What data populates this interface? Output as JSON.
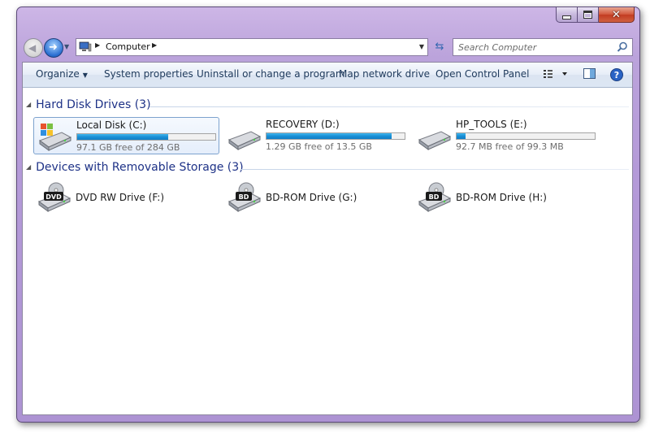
{
  "window": {
    "caption_buttons": {
      "minimize": "minimize",
      "maximize": "maximize",
      "close": "✕"
    }
  },
  "address_bar": {
    "location": "Computer",
    "icon": "computer-icon"
  },
  "search": {
    "placeholder": "Search Computer"
  },
  "toolbar": {
    "organize_label": "Organize",
    "system_properties_label": "System properties",
    "uninstall_label": "Uninstall or change a program",
    "map_network_label": "Map network drive",
    "control_panel_label": "Open Control Panel"
  },
  "groups": [
    {
      "title": "Hard Disk Drives (3)",
      "drives": [
        {
          "name": "Local Disk (C:)",
          "free_text": "97.1 GB free of 284 GB",
          "used_fraction": 0.658,
          "icon": "windows-drive-icon",
          "selected": true
        },
        {
          "name": "RECOVERY (D:)",
          "free_text": "1.29 GB free of 13.5 GB",
          "used_fraction": 0.904,
          "icon": "hard-drive-icon",
          "selected": false
        },
        {
          "name": "HP_TOOLS (E:)",
          "free_text": "92.7 MB free of 99.3 MB",
          "used_fraction": 0.066,
          "icon": "hard-drive-icon",
          "selected": false
        }
      ]
    },
    {
      "title": "Devices with Removable Storage (3)",
      "drives": [
        {
          "name": "DVD RW Drive (F:)",
          "badge": "DVD",
          "icon": "dvd-drive-icon"
        },
        {
          "name": "BD-ROM Drive (G:)",
          "badge": "BD",
          "icon": "bd-drive-icon"
        },
        {
          "name": "BD-ROM Drive (H:)",
          "badge": "BD",
          "icon": "bd-drive-icon"
        }
      ]
    }
  ],
  "colors": {
    "accent_bar": "#1a8ed4",
    "group_header": "#1e3287",
    "frame": "#b49ad8"
  }
}
